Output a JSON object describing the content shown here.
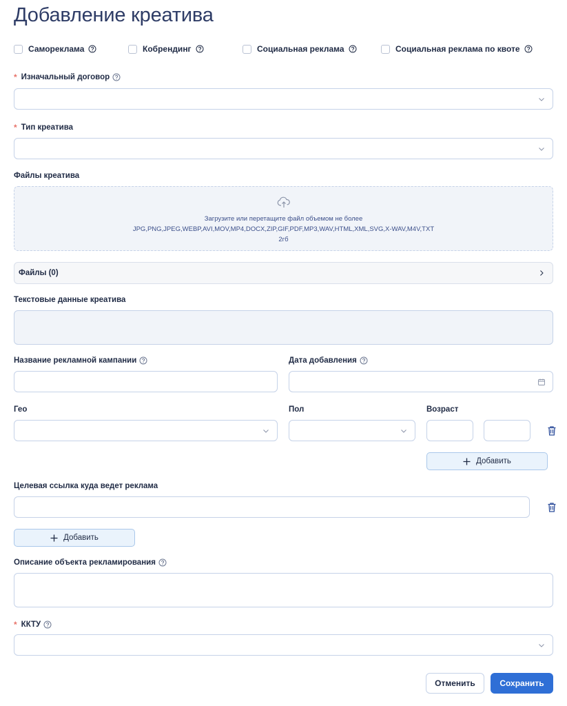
{
  "page_title": "Добавление креатива",
  "checkboxes": [
    {
      "label": "Самореклама"
    },
    {
      "label": "Кобрендинг"
    },
    {
      "label": "Социальная реклама"
    },
    {
      "label": "Социальная реклама по квоте"
    }
  ],
  "required_mark": "*",
  "contract": {
    "label": "Изначальный договор",
    "value": ""
  },
  "creative_type": {
    "label": "Тип креатива",
    "value": ""
  },
  "creative_files": {
    "label": "Файлы креатива",
    "upload_line1": "Загрузите или перетащите файл объемом не более",
    "upload_line2": "JPG,PNG,JPEG,WEBP,AVI,MOV,MP4,DOCX,ZIP,GIF,PDF,MP3,WAV,HTML,XML,SVG,X-WAV,M4V,TXT",
    "upload_line3": "2гб",
    "files_list_label": "Файлы (0)"
  },
  "text_data": {
    "label": "Текстовые данные креатива",
    "value": ""
  },
  "campaign_name": {
    "label": "Название рекламной кампании",
    "value": ""
  },
  "date_added": {
    "label": "Дата добавления",
    "value": ""
  },
  "geo": {
    "label": "Гео",
    "value": ""
  },
  "gender": {
    "label": "Пол",
    "value": ""
  },
  "age": {
    "label": "Возраст",
    "from": "",
    "to": ""
  },
  "add_label": "Добавить",
  "target_link": {
    "label": "Целевая ссылка куда ведет реклама",
    "value": ""
  },
  "description": {
    "label": "Описание объекта рекламирования",
    "value": ""
  },
  "kktu": {
    "label": "ККТУ",
    "value": ""
  },
  "actions": {
    "cancel": "Отменить",
    "save": "Сохранить"
  },
  "colors": {
    "accent": "#2f6fd6",
    "title": "#2e3c66",
    "required": "#e8736a",
    "border": "#c5d2e8",
    "add_bg": "#eaf3fc"
  },
  "icons": [
    "help-icon",
    "chevron-down-icon",
    "chevron-right-icon",
    "upload-cloud-icon",
    "calendar-icon",
    "trash-icon",
    "plus-icon"
  ]
}
